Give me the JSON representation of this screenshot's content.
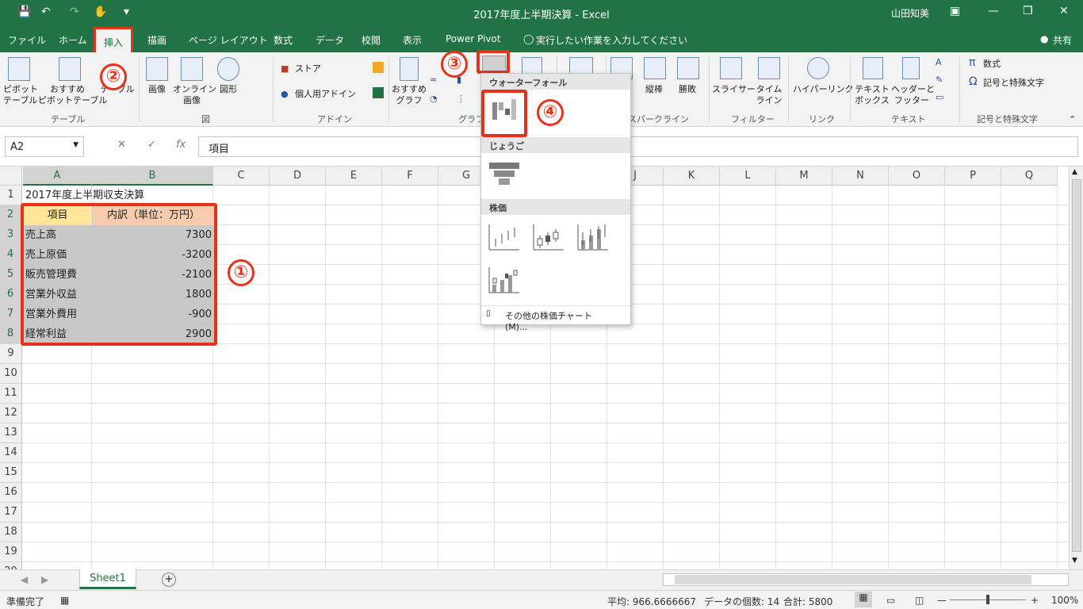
{
  "window": {
    "title": "2017年度上半期決算 - Excel",
    "user": "山田知美",
    "qa_icons": [
      "save-icon",
      "undo-icon",
      "redo-icon",
      "touch-icon",
      "customize-icon"
    ]
  },
  "tabs": [
    "ファイル",
    "ホーム",
    "挿入",
    "描画",
    "ページ レイアウト",
    "数式",
    "データ",
    "校閲",
    "表示",
    "Power Pivot"
  ],
  "active_tab": "挿入",
  "tell_me": "実行したい作業を入力してください",
  "share": "共有",
  "ribbon": {
    "pivot": "ピボット\nテーブル",
    "rec_pivot": "おすすめ\nピボットテーブル",
    "table": "テーブル",
    "picture": "画像",
    "online_picture": "オンライン\n画像",
    "shapes": "図形",
    "store": "ストア",
    "my_addins": "個人用アドイン",
    "rec_charts": "おすすめ\nグラフ",
    "col_spark": "縦棒",
    "winloss": "勝敗",
    "slicer": "スライサー",
    "timeline": "タイム\nライン",
    "hyperlink": "ハイパーリンク",
    "textbox": "テキスト\nボックス",
    "header_footer": "ヘッダーと\nフッター",
    "equation": "数式",
    "symbol": "記号と特殊文字",
    "groups": {
      "table": "テーブル",
      "illustration": "図",
      "addin": "アドイン",
      "chart": "グラフ",
      "sparkline": "スパークライン",
      "filter": "フィルター",
      "link": "リンク",
      "text": "テキスト",
      "symbols": "記号と特殊文字"
    }
  },
  "formula_bar": {
    "name_box": "A2",
    "fx": "fx",
    "formula": "項目"
  },
  "columns": [
    "A",
    "B",
    "C",
    "D",
    "E",
    "F",
    "G",
    "H",
    "I",
    "J",
    "K",
    "L",
    "M",
    "N",
    "O",
    "P",
    "Q"
  ],
  "rows": [
    "1",
    "2",
    "3",
    "4",
    "5",
    "6",
    "7",
    "8",
    "9",
    "10",
    "11",
    "12",
    "13",
    "14",
    "15",
    "16",
    "17",
    "18",
    "19",
    "20"
  ],
  "cells": {
    "a1": "2017年度上半期収支決算",
    "header_a": "項目",
    "header_b": "内訳（単位：万円）",
    "items": [
      {
        "label": "売上高",
        "value": "7300"
      },
      {
        "label": "売上原価",
        "value": "-3200"
      },
      {
        "label": "販売管理費",
        "value": "-2100"
      },
      {
        "label": "営業外収益",
        "value": "1800"
      },
      {
        "label": "営業外費用",
        "value": "-900"
      },
      {
        "label": "経常利益",
        "value": "2900"
      }
    ]
  },
  "dropdown": {
    "waterfall": "ウォーターフォール",
    "funnel": "じょうご",
    "stock": "株価",
    "more": "その他の株価チャート(M)..."
  },
  "annotations": [
    "①",
    "②",
    "③",
    "④"
  ],
  "sheet": {
    "tab": "Sheet1"
  },
  "status": {
    "ready": "準備完了",
    "average": "平均: 966.6666667",
    "count": "データの個数: 14",
    "sum": "合計: 5800",
    "zoom": "100%"
  },
  "colors": {
    "accent": "#217346",
    "highlight": "#e8311a",
    "header_a": "#ffe699",
    "header_b": "#f8cbad"
  }
}
